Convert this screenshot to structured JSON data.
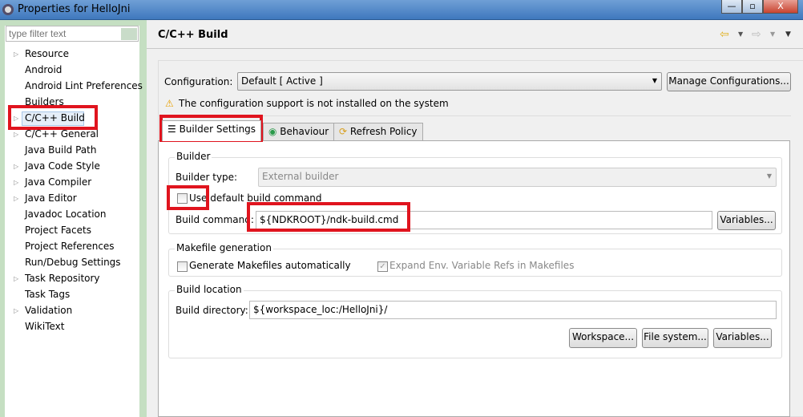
{
  "window": {
    "title": "Properties for HelloJni",
    "min": "—",
    "max": "▫",
    "close": "X"
  },
  "sidebar": {
    "filter_placeholder": "type filter text",
    "items": [
      {
        "label": "Resource",
        "expandable": true
      },
      {
        "label": "Android",
        "expandable": false
      },
      {
        "label": "Android Lint Preferences",
        "expandable": false
      },
      {
        "label": "Builders",
        "expandable": false
      },
      {
        "label": "C/C++ Build",
        "expandable": true,
        "selected": true
      },
      {
        "label": "C/C++ General",
        "expandable": true
      },
      {
        "label": "Java Build Path",
        "expandable": false
      },
      {
        "label": "Java Code Style",
        "expandable": true
      },
      {
        "label": "Java Compiler",
        "expandable": true
      },
      {
        "label": "Java Editor",
        "expandable": true
      },
      {
        "label": "Javadoc Location",
        "expandable": false
      },
      {
        "label": "Project Facets",
        "expandable": false
      },
      {
        "label": "Project References",
        "expandable": false
      },
      {
        "label": "Run/Debug Settings",
        "expandable": false
      },
      {
        "label": "Task Repository",
        "expandable": true
      },
      {
        "label": "Task Tags",
        "expandable": false
      },
      {
        "label": "Validation",
        "expandable": true
      },
      {
        "label": "WikiText",
        "expandable": false
      }
    ]
  },
  "main": {
    "title": "C/C++ Build",
    "configuration": {
      "label": "Configuration:",
      "value": "Default  [ Active ]",
      "manage_button": "Manage Configurations..."
    },
    "warning": "The configuration support is not installed on the system",
    "tabs": [
      {
        "label": "Builder Settings",
        "active": true
      },
      {
        "label": "Behaviour"
      },
      {
        "label": "Refresh Policy"
      }
    ],
    "builder": {
      "group": "Builder",
      "type_label": "Builder type:",
      "type_value": "External builder",
      "use_default_label": "Use default build command",
      "use_default_checked": false,
      "command_label": "Build command:",
      "command_value": "${NDKROOT}/ndk-build.cmd",
      "variables_button": "Variables..."
    },
    "makefile": {
      "group": "Makefile generation",
      "generate_label": "Generate Makefiles automatically",
      "generate_checked": false,
      "expand_label": "Expand Env. Variable Refs in Makefiles",
      "expand_checked": true
    },
    "location": {
      "group": "Build location",
      "dir_label": "Build directory:",
      "dir_value": "${workspace_loc:/HelloJni}/",
      "workspace_button": "Workspace...",
      "filesystem_button": "File system...",
      "variables_button": "Variables..."
    }
  },
  "colors": {
    "highlight": "#e0141e",
    "titlebar": "#4a82c4"
  }
}
